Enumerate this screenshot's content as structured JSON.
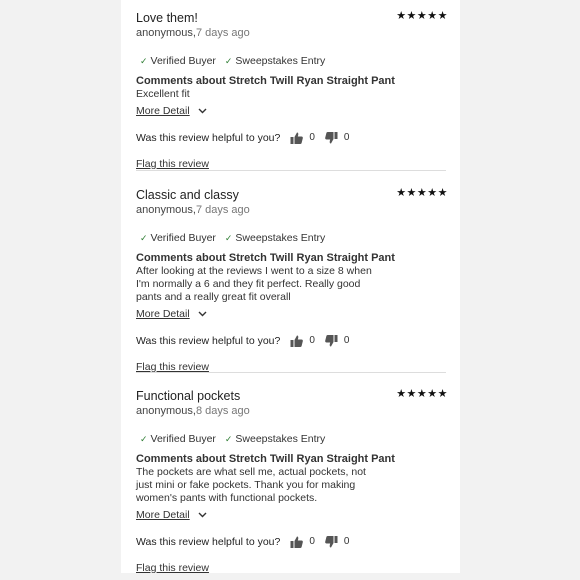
{
  "helpful_prompt": "Was this review helpful to you?",
  "flag_label": "Flag this review",
  "more_detail_label": "More Detail",
  "badges": [
    "Verified Buyer",
    "Sweepstakes Entry"
  ],
  "reviews": [
    {
      "title": "Love them!",
      "author": "anonymous,",
      "ago": "7 days ago",
      "stars": "★★★★★",
      "comments_title": "Comments about Stretch Twill Ryan Straight Pant",
      "body": "Excellent fit",
      "up": "0",
      "down": "0"
    },
    {
      "title": "Classic and classy",
      "author": "anonymous,",
      "ago": "7 days ago",
      "stars": "★★★★★",
      "comments_title": "Comments about Stretch Twill Ryan Straight Pant",
      "body": "After looking at the reviews I went to a size 8 when I'm normally a 6 and they fit perfect. Really good pants and a really great fit overall",
      "up": "0",
      "down": "0"
    },
    {
      "title": "Functional pockets",
      "author": "anonymous,",
      "ago": "8 days ago",
      "stars": "★★★★★",
      "comments_title": "Comments about Stretch Twill Ryan Straight Pant",
      "body": "The pockets are what sell me, actual pockets, not just mini or fake pockets. Thank you for making women's pants with functional pockets.",
      "up": "0",
      "down": "0"
    }
  ]
}
